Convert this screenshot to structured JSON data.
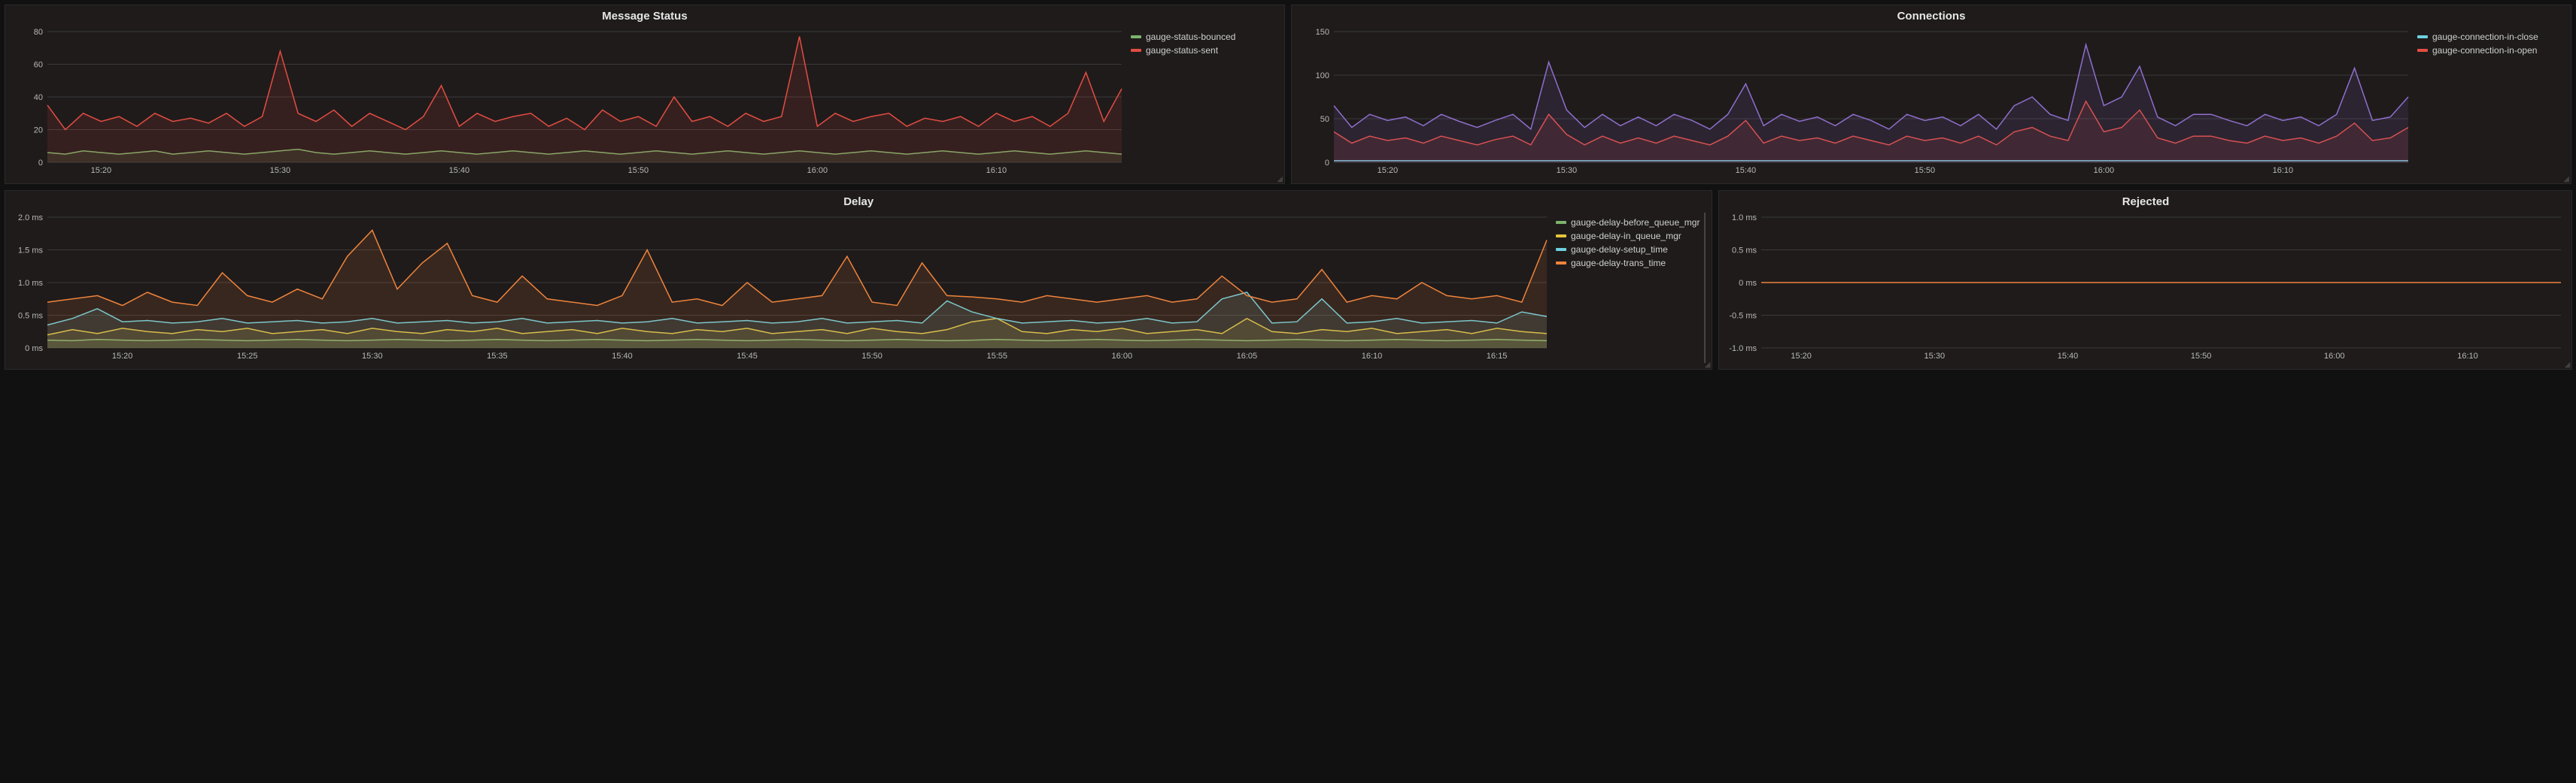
{
  "colors": {
    "green": "#7eb26d",
    "red": "#e24d42",
    "blue": "#6ed0e0",
    "orange": "#ef843c",
    "yellow": "#e5c43a",
    "purple": "#8e6fce"
  },
  "chart_data": [
    {
      "id": "message_status",
      "title": "Message Status",
      "type": "line",
      "x": [
        "15:20",
        "15:30",
        "15:40",
        "15:50",
        "16:00",
        "16:10"
      ],
      "xlabel": "",
      "ylabel": "",
      "ylim": [
        0,
        80
      ],
      "yticks": [
        0,
        20,
        40,
        60,
        80
      ],
      "x_step_minutes": 1,
      "x_start_minute": 917,
      "x_end_minute": 977,
      "series": [
        {
          "name": "gauge-status-bounced",
          "color": "green",
          "legend_label": "gauge-status-bounced",
          "values": [
            6,
            5,
            7,
            6,
            5,
            6,
            7,
            5,
            6,
            7,
            6,
            5,
            6,
            7,
            8,
            6,
            5,
            6,
            7,
            6,
            5,
            6,
            7,
            6,
            5,
            6,
            7,
            6,
            5,
            6,
            7,
            6,
            5,
            6,
            7,
            6,
            5,
            6,
            7,
            6,
            5,
            6,
            7,
            6,
            5,
            6,
            7,
            6,
            5,
            6,
            7,
            6,
            5,
            6,
            7,
            6,
            5,
            6,
            7,
            6,
            5
          ]
        },
        {
          "name": "gauge-status-sent",
          "color": "red",
          "legend_label": "gauge-status-sent",
          "values": [
            35,
            20,
            30,
            25,
            28,
            22,
            30,
            25,
            27,
            24,
            30,
            22,
            28,
            68,
            30,
            25,
            32,
            22,
            30,
            25,
            20,
            28,
            47,
            22,
            30,
            25,
            28,
            30,
            22,
            27,
            20,
            32,
            25,
            28,
            22,
            40,
            25,
            28,
            22,
            30,
            25,
            28,
            77,
            22,
            30,
            25,
            28,
            30,
            22,
            27,
            25,
            28,
            22,
            30,
            25,
            28,
            22,
            30,
            55,
            25,
            45
          ]
        }
      ]
    },
    {
      "id": "connections",
      "title": "Connections",
      "type": "line",
      "x": [
        "15:20",
        "15:30",
        "15:40",
        "15:50",
        "16:00",
        "16:10"
      ],
      "xlabel": "",
      "ylabel": "",
      "ylim": [
        0,
        150
      ],
      "yticks": [
        0,
        50,
        100,
        150
      ],
      "x_step_minutes": 1,
      "x_start_minute": 917,
      "x_end_minute": 977,
      "series": [
        {
          "name": "gauge-connection-in-close",
          "color": "blue",
          "legend_label": "gauge-connection-in-close",
          "values": [
            2,
            2,
            2,
            2,
            2,
            2,
            2,
            2,
            2,
            2,
            2,
            2,
            2,
            2,
            2,
            2,
            2,
            2,
            2,
            2,
            2,
            2,
            2,
            2,
            2,
            2,
            2,
            2,
            2,
            2,
            2,
            2,
            2,
            2,
            2,
            2,
            2,
            2,
            2,
            2,
            2,
            2,
            2,
            2,
            2,
            2,
            2,
            2,
            2,
            2,
            2,
            2,
            2,
            2,
            2,
            2,
            2,
            2,
            2,
            2,
            2
          ]
        },
        {
          "name": "gauge-connection-in-open",
          "color": "red",
          "legend_label": "gauge-connection-in-open",
          "values": [
            35,
            22,
            30,
            25,
            28,
            22,
            30,
            25,
            20,
            26,
            30,
            20,
            55,
            32,
            20,
            30,
            22,
            28,
            22,
            30,
            25,
            20,
            30,
            48,
            22,
            30,
            25,
            28,
            22,
            30,
            25,
            20,
            30,
            25,
            28,
            22,
            30,
            20,
            35,
            40,
            30,
            25,
            70,
            35,
            40,
            60,
            28,
            22,
            30,
            30,
            25,
            22,
            30,
            25,
            28,
            22,
            30,
            45,
            25,
            28,
            40
          ]
        },
        {
          "name": "sum-line",
          "color": "purple",
          "legend_label": "",
          "hidden_legend": true,
          "values": [
            65,
            40,
            55,
            48,
            52,
            42,
            55,
            47,
            40,
            48,
            55,
            38,
            115,
            60,
            40,
            55,
            42,
            52,
            42,
            55,
            48,
            38,
            55,
            90,
            42,
            55,
            47,
            52,
            42,
            55,
            48,
            38,
            55,
            48,
            52,
            42,
            55,
            38,
            65,
            75,
            55,
            48,
            135,
            65,
            75,
            110,
            52,
            42,
            55,
            55,
            48,
            42,
            55,
            48,
            52,
            42,
            55,
            108,
            48,
            52,
            75
          ]
        }
      ]
    },
    {
      "id": "delay",
      "title": "Delay",
      "type": "line",
      "x": [
        "15:20",
        "15:25",
        "15:30",
        "15:35",
        "15:40",
        "15:45",
        "15:50",
        "15:55",
        "16:00",
        "16:05",
        "16:10",
        "16:15"
      ],
      "xlabel": "",
      "ylabel": "",
      "ylim": [
        0,
        2.0
      ],
      "yticks": [
        0,
        0.5,
        1.0,
        1.5,
        2.0
      ],
      "ytick_labels": [
        "0 ms",
        "0.5 ms",
        "1.0 ms",
        "1.5 ms",
        "2.0 ms"
      ],
      "x_step_minutes": 1,
      "x_start_minute": 917,
      "x_end_minute": 977,
      "legend_scrollable": true,
      "series": [
        {
          "name": "gauge-delay-before_queue_mgr",
          "color": "green",
          "legend_label": "gauge-delay-before_queue_mgr",
          "values": [
            0.12,
            0.11,
            0.13,
            0.12,
            0.11,
            0.12,
            0.13,
            0.12,
            0.11,
            0.12,
            0.13,
            0.12,
            0.11,
            0.12,
            0.13,
            0.12,
            0.11,
            0.12,
            0.13,
            0.12,
            0.11,
            0.12,
            0.13,
            0.12,
            0.11,
            0.12,
            0.13,
            0.12,
            0.11,
            0.12,
            0.13,
            0.12,
            0.11,
            0.12,
            0.13,
            0.12,
            0.11,
            0.12,
            0.13,
            0.12,
            0.11,
            0.12,
            0.13,
            0.12,
            0.11,
            0.12,
            0.13,
            0.12,
            0.11,
            0.12,
            0.13,
            0.12,
            0.11,
            0.12,
            0.13,
            0.12,
            0.11,
            0.12,
            0.13,
            0.12,
            0.11
          ]
        },
        {
          "name": "gauge-delay-in_queue_mgr",
          "color": "yellow",
          "legend_label": "gauge-delay-in_queue_mgr",
          "values": [
            0.2,
            0.28,
            0.22,
            0.3,
            0.25,
            0.22,
            0.28,
            0.25,
            0.3,
            0.22,
            0.25,
            0.28,
            0.22,
            0.3,
            0.25,
            0.22,
            0.28,
            0.25,
            0.3,
            0.22,
            0.25,
            0.28,
            0.22,
            0.3,
            0.25,
            0.22,
            0.28,
            0.25,
            0.3,
            0.22,
            0.25,
            0.28,
            0.22,
            0.3,
            0.25,
            0.22,
            0.28,
            0.4,
            0.45,
            0.25,
            0.22,
            0.28,
            0.25,
            0.3,
            0.22,
            0.25,
            0.28,
            0.22,
            0.45,
            0.25,
            0.22,
            0.28,
            0.25,
            0.3,
            0.22,
            0.25,
            0.28,
            0.22,
            0.3,
            0.25,
            0.22
          ]
        },
        {
          "name": "gauge-delay-setup_time",
          "color": "blue",
          "legend_label": "gauge-delay-setup_time",
          "values": [
            0.35,
            0.45,
            0.6,
            0.4,
            0.42,
            0.38,
            0.4,
            0.45,
            0.38,
            0.4,
            0.42,
            0.38,
            0.4,
            0.45,
            0.38,
            0.4,
            0.42,
            0.38,
            0.4,
            0.45,
            0.38,
            0.4,
            0.42,
            0.38,
            0.4,
            0.45,
            0.38,
            0.4,
            0.42,
            0.38,
            0.4,
            0.45,
            0.38,
            0.4,
            0.42,
            0.38,
            0.72,
            0.55,
            0.45,
            0.38,
            0.4,
            0.42,
            0.38,
            0.4,
            0.45,
            0.38,
            0.4,
            0.75,
            0.85,
            0.38,
            0.4,
            0.75,
            0.38,
            0.4,
            0.45,
            0.38,
            0.4,
            0.42,
            0.38,
            0.55,
            0.48
          ]
        },
        {
          "name": "gauge-delay-trans_time",
          "color": "orange",
          "legend_label": "gauge-delay-trans_time",
          "values": [
            0.7,
            0.75,
            0.8,
            0.65,
            0.85,
            0.7,
            0.65,
            1.15,
            0.8,
            0.7,
            0.9,
            0.75,
            1.4,
            1.8,
            0.9,
            1.3,
            1.6,
            0.8,
            0.7,
            1.1,
            0.75,
            0.7,
            0.65,
            0.8,
            1.5,
            0.7,
            0.75,
            0.65,
            1.0,
            0.7,
            0.75,
            0.8,
            1.4,
            0.7,
            0.65,
            1.3,
            0.8,
            0.78,
            0.75,
            0.7,
            0.8,
            0.75,
            0.7,
            0.75,
            0.8,
            0.7,
            0.75,
            1.1,
            0.8,
            0.7,
            0.75,
            1.2,
            0.7,
            0.8,
            0.75,
            1.0,
            0.8,
            0.75,
            0.8,
            0.7,
            1.65
          ]
        }
      ]
    },
    {
      "id": "rejected",
      "title": "Rejected",
      "type": "line",
      "x": [
        "15:20",
        "15:30",
        "15:40",
        "15:50",
        "16:00",
        "16:10"
      ],
      "xlabel": "",
      "ylabel": "",
      "ylim": [
        -1.0,
        1.0
      ],
      "yticks": [
        -1.0,
        -0.5,
        0,
        0.5,
        1.0
      ],
      "ytick_labels": [
        "-1.0 ms",
        "-0.5 ms",
        "0 ms",
        "0.5 ms",
        "1.0 ms"
      ],
      "x_step_minutes": 1,
      "x_start_minute": 917,
      "x_end_minute": 977,
      "no_legend": true,
      "series": [
        {
          "name": "rejected",
          "color": "orange",
          "legend_label": "",
          "values": [
            0,
            0,
            0,
            0,
            0,
            0,
            0,
            0,
            0,
            0,
            0,
            0,
            0,
            0,
            0,
            0,
            0,
            0,
            0,
            0,
            0,
            0,
            0,
            0,
            0,
            0,
            0,
            0,
            0,
            0,
            0,
            0,
            0,
            0,
            0,
            0,
            0,
            0,
            0,
            0,
            0,
            0,
            0,
            0,
            0,
            0,
            0,
            0,
            0,
            0,
            0,
            0,
            0,
            0,
            0,
            0,
            0,
            0,
            0,
            0,
            0
          ]
        }
      ]
    }
  ]
}
